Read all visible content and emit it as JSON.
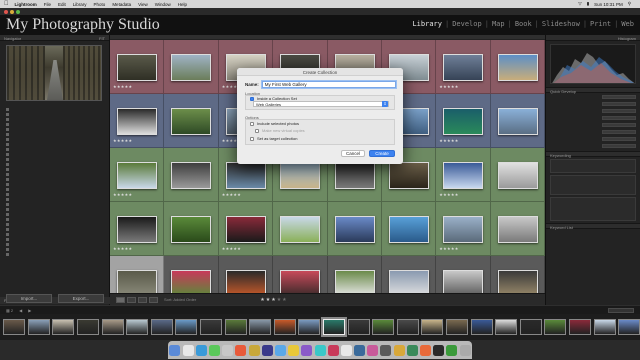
{
  "menubar": {
    "apple": "",
    "items": [
      "Lightroom",
      "File",
      "Edit",
      "Library",
      "Photo",
      "Metadata",
      "View",
      "Window",
      "Help"
    ],
    "clock": "Sun 10:31 PM"
  },
  "identity_plate": "My Photography Studio",
  "modules": [
    "Library",
    "Develop",
    "Map",
    "Book",
    "Slideshow",
    "Print",
    "Web"
  ],
  "active_module": "Library",
  "left_panel": {
    "navigator_label": "Navigator",
    "publish_services": "Publish Services"
  },
  "right_panel": {
    "histogram_label": "Histogram",
    "quick_develop_label": "Quick Develop",
    "keywording_label": "Keywording",
    "keyword_list_label": "Keyword List",
    "metadata_label": "Metadata"
  },
  "toolbar": {
    "sort_label": "Sort: Added Order"
  },
  "buttons": {
    "import": "Import...",
    "export": "Export..."
  },
  "dialog": {
    "title": "Create Collection",
    "name_label": "Name:",
    "name_value": "My First Web Gallery",
    "location_label": "Location",
    "inside_set_label": "Inside a Collection Set",
    "set_value": "Web Galleries",
    "options_label": "Options",
    "include_selected": "Include selected photos",
    "make_virtual": "Make new virtual copies",
    "set_target": "Set as target collection",
    "cancel": "Cancel",
    "create": "Create"
  },
  "colors": {
    "red_label": "#8a5a64",
    "blue_label": "#5e6a86",
    "green_label": "#6d8a62",
    "accent": "#3c82f0"
  }
}
